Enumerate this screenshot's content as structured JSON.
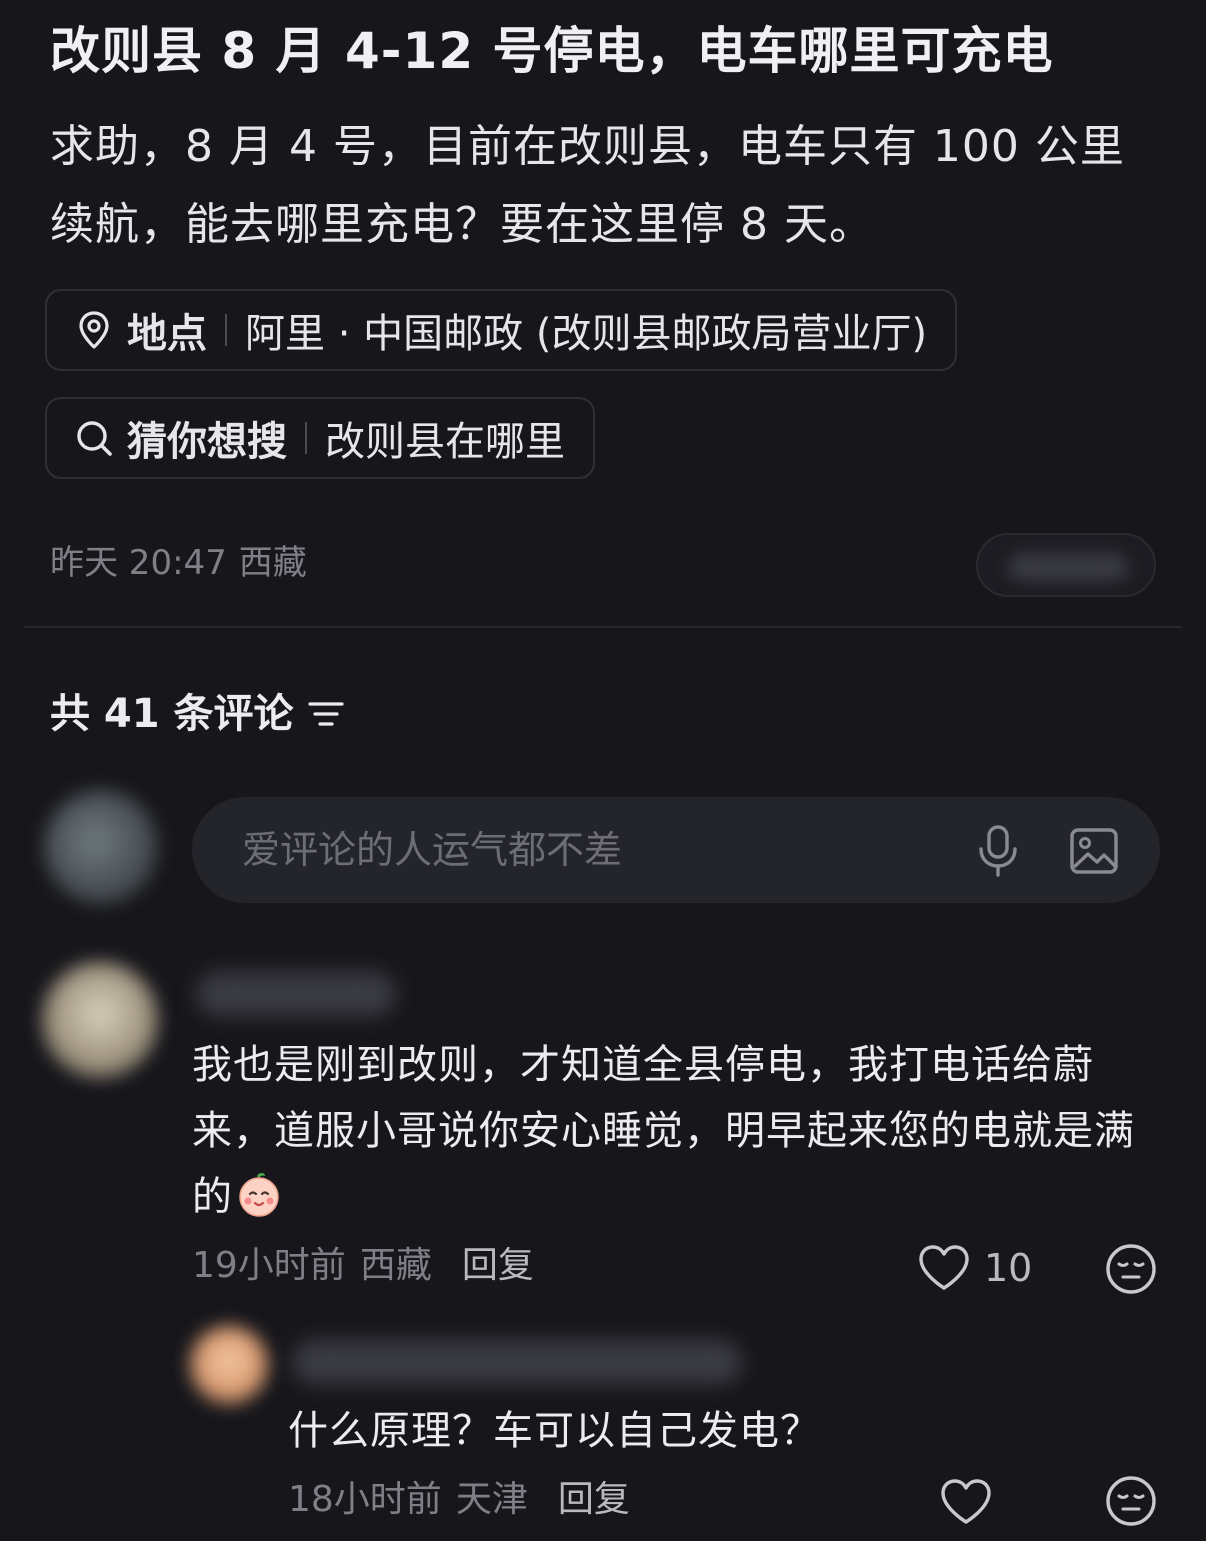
{
  "post": {
    "title": "改则县 8 月 4-12 号停电，电车哪里可充电",
    "body": "求助，8 月 4 号，目前在改则县，电车只有 100 公里续航，能去哪里充电？要在这里停 8 天。",
    "location_chip": {
      "key": "地点",
      "value": "阿里 · 中国邮政 (改则县邮政局营业厅)"
    },
    "search_chip": {
      "key": "猜你想搜",
      "value": "改则县在哪里"
    },
    "time": "昨天 20:47",
    "region": "西藏"
  },
  "comments_header": {
    "label": "共 41 条评论"
  },
  "comment_input": {
    "placeholder": "爱评论的人运气都不差"
  },
  "comments": [
    {
      "text": "我也是刚到改则，才知道全县停电，我打电话给蔚来，道服小哥说你安心睡觉，明早起来您的电就是满的",
      "time": "19小时前",
      "location": "西藏",
      "reply_label": "回复",
      "likes": "10",
      "emoji": "baby-face-emoji"
    },
    {
      "text": "什么原理？车可以自己发电？",
      "time": "18小时前",
      "location": "天津",
      "reply_label": "回复",
      "likes": ""
    }
  ],
  "icons": {
    "location": "map-pin-icon",
    "search": "search-icon",
    "filter": "filter-lines-icon",
    "mic": "microphone-icon",
    "image": "image-icon",
    "heart": "heart-outline-icon",
    "dislike": "meh-face-icon"
  },
  "colors": {
    "background": "#16161b",
    "text_primary": "#ececee",
    "text_secondary": "#7f7f88",
    "input_bg": "#24242b"
  }
}
